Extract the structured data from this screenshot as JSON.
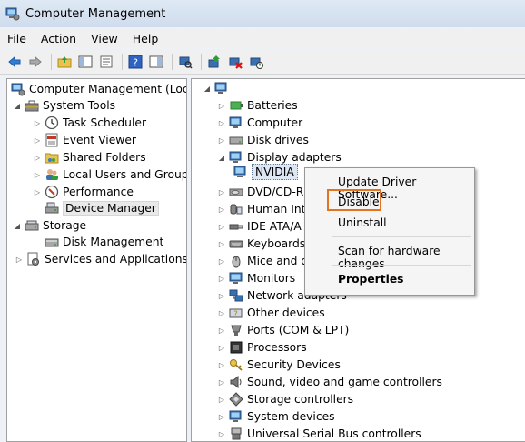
{
  "window": {
    "title": "Computer Management"
  },
  "menu": [
    "File",
    "Action",
    "View",
    "Help"
  ],
  "toolbar": [
    "back-arrow-icon",
    "forward-arrow-icon",
    "folder-up-icon",
    "show-tree-icon",
    "properties-icon",
    "help-icon",
    "console-icon",
    "scan-hardware-icon",
    "update-driver-icon",
    "uninstall-icon",
    "enable-device-icon"
  ],
  "left_tree": {
    "root": "Computer Management (Local",
    "system_tools": "System Tools",
    "items": [
      "Task Scheduler",
      "Event Viewer",
      "Shared Folders",
      "Local Users and Groups",
      "Performance",
      "Device Manager"
    ],
    "storage": "Storage",
    "disk_management": "Disk Management",
    "services": "Services and Applications"
  },
  "device_tree": {
    "categories_top": [
      "Batteries",
      "Computer",
      "Disk drives",
      "Display adapters"
    ],
    "nvidia": "NVIDIA",
    "partial": [
      "DVD/CD-R",
      "Human Int",
      "IDE ATA/A",
      "Keyboards",
      "Mice and o",
      "Monitors",
      "Network adapters",
      "Other devices",
      "Ports (COM & LPT)",
      "Processors",
      "Security Devices",
      "Sound, video and game controllers",
      "Storage controllers",
      "System devices",
      "Universal Serial Bus controllers"
    ]
  },
  "context_menu": {
    "update": "Update Driver Software...",
    "disable": "Disable",
    "uninstall": "Uninstall",
    "scan": "Scan for hardware changes",
    "properties": "Properties",
    "highlight_color": "#e3741f"
  }
}
